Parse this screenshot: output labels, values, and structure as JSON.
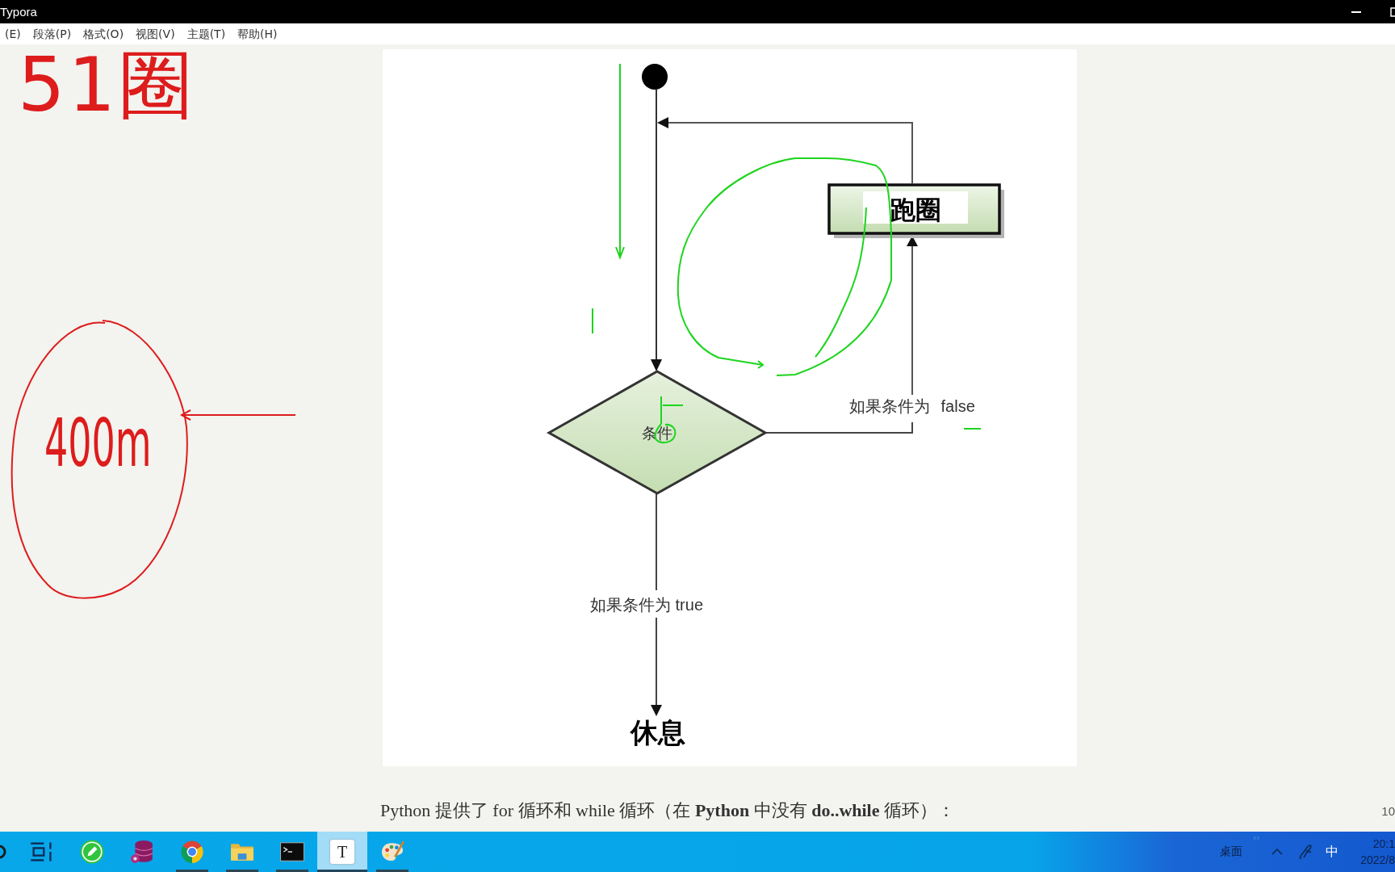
{
  "window": {
    "title": "Typora"
  },
  "menu_bar": {
    "items": [
      "(E)",
      "段落(P)",
      "格式(O)",
      "视图(V)",
      "主题(T)",
      "帮助(H)"
    ]
  },
  "handwriting": [
    "51圈",
    "400m"
  ],
  "flowchart": {
    "loop_box": "跑圈",
    "decision": "条件",
    "false_label": "如果条件为 false",
    "true_label": "如果条件为 true",
    "end_label": "休息"
  },
  "paragraph": "Python 提供了 for 循环和 while 循环（在 **Python** 中没有 **do..while** 循环）：",
  "page_number": "10",
  "taskbar": {
    "apps": [
      {
        "kind": "taskview",
        "running": false,
        "selected": false
      },
      {
        "kind": "notes",
        "running": false,
        "selected": false
      },
      {
        "kind": "database",
        "running": false,
        "selected": false
      },
      {
        "kind": "browser",
        "running": true,
        "selected": false
      },
      {
        "kind": "folder",
        "running": true,
        "selected": false
      },
      {
        "kind": "terminal",
        "running": true,
        "selected": false
      },
      {
        "kind": "editor",
        "label": "T",
        "running": true,
        "selected": true
      },
      {
        "kind": "paint",
        "running": true,
        "selected": false
      }
    ],
    "tray": {
      "desktop": "桌面",
      "input_method": "中",
      "time": "20:1",
      "date": "2022/8"
    }
  }
}
